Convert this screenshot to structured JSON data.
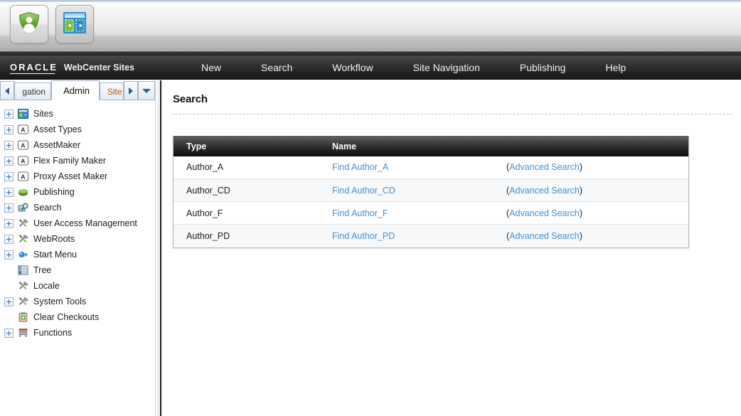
{
  "toolbar": {
    "buttons": [
      {
        "name": "contributor-shield-button",
        "icon": "shield-person-icon",
        "label": ""
      },
      {
        "name": "site-layout-button",
        "icon": "site-panels-add-icon",
        "label": ""
      }
    ]
  },
  "brandbar": {
    "oracle_logo_text": "ORACLE",
    "product_name": "WebCenter Sites",
    "menu": [
      {
        "label": "New"
      },
      {
        "label": "Search"
      },
      {
        "label": "Workflow"
      },
      {
        "label": "Site Navigation"
      },
      {
        "label": "Publishing"
      },
      {
        "label": "Help"
      }
    ]
  },
  "sidebar": {
    "tabs": {
      "prev_arrow": "◀",
      "next_arrow": "▶",
      "dropdown_arrow": "▼",
      "items": [
        {
          "label": "gation",
          "active": false
        },
        {
          "label": "Admin",
          "active": true
        },
        {
          "label": "Site",
          "active": false
        }
      ]
    },
    "tree": [
      {
        "label": "Sites",
        "icon": "sites-icon",
        "expandable": true
      },
      {
        "label": "Asset Types",
        "icon": "asset-a-icon",
        "expandable": true
      },
      {
        "label": "AssetMaker",
        "icon": "asset-a-icon",
        "expandable": true
      },
      {
        "label": "Flex Family Maker",
        "icon": "asset-a-icon",
        "expandable": true
      },
      {
        "label": "Proxy Asset Maker",
        "icon": "asset-a-icon",
        "expandable": true
      },
      {
        "label": "Publishing",
        "icon": "publishing-icon",
        "expandable": true
      },
      {
        "label": "Search",
        "icon": "search-icon",
        "expandable": true
      },
      {
        "label": "User Access Management",
        "icon": "tools-icon",
        "expandable": true
      },
      {
        "label": "WebRoots",
        "icon": "tools-icon",
        "expandable": true
      },
      {
        "label": "Start Menu",
        "icon": "start-menu-icon",
        "expandable": true
      },
      {
        "label": "Tree",
        "icon": "tree-list-icon",
        "expandable": false
      },
      {
        "label": "Locale",
        "icon": "tools-icon",
        "expandable": false
      },
      {
        "label": "System Tools",
        "icon": "tools-icon",
        "expandable": true
      },
      {
        "label": "Clear Checkouts",
        "icon": "clipboard-up-icon",
        "expandable": false
      },
      {
        "label": "Functions",
        "icon": "functions-icon",
        "expandable": true
      }
    ]
  },
  "main": {
    "page_title": "Search",
    "table": {
      "headers": [
        "Type",
        "Name",
        ""
      ],
      "rows": [
        {
          "type": "Author_A",
          "find_label": "Find Author_A",
          "advanced_open": "(",
          "advanced_label": "Advanced Search",
          "advanced_close": ")"
        },
        {
          "type": "Author_CD",
          "find_label": "Find Author_CD",
          "advanced_open": "(",
          "advanced_label": "Advanced Search",
          "advanced_close": ")"
        },
        {
          "type": "Author_F",
          "find_label": "Find Author_F",
          "advanced_open": "(",
          "advanced_label": "Advanced Search",
          "advanced_close": ")"
        },
        {
          "type": "Author_PD",
          "find_label": "Find Author_PD",
          "advanced_open": "(",
          "advanced_label": "Advanced Search",
          "advanced_close": ")"
        }
      ]
    }
  },
  "colors": {
    "link_blue": "#4b90c8",
    "brandbar_dark": "#2b2b2b",
    "table_header_dark": "#0c0c0c",
    "row_alt": "#f6f8fa",
    "tab_inactive_text": "#a05a12"
  }
}
